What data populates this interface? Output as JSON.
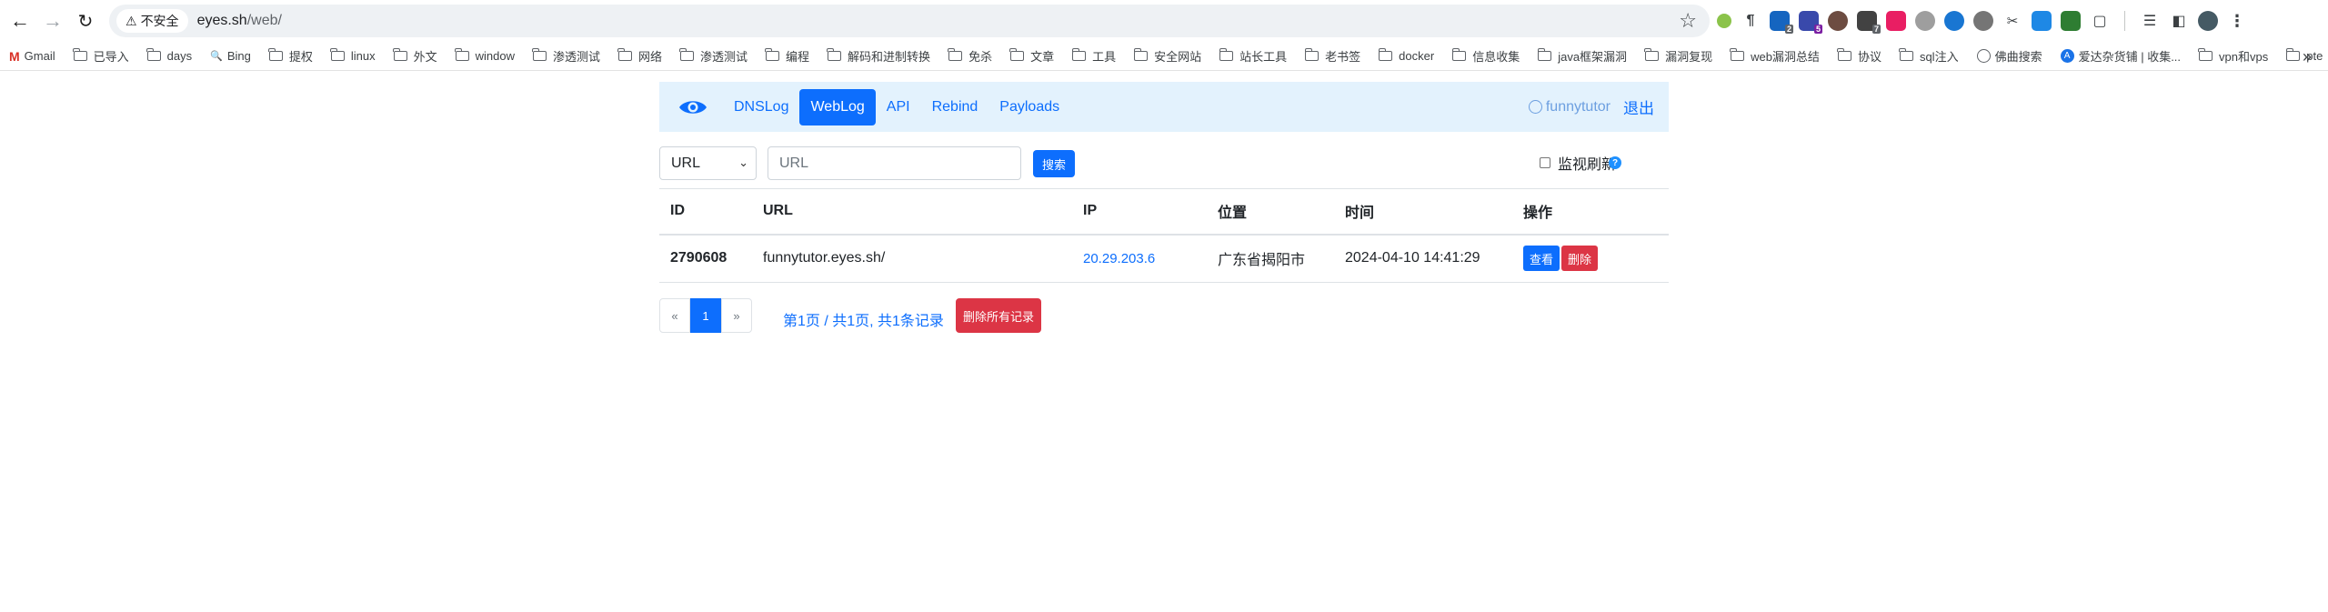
{
  "browser": {
    "security_label": "不安全",
    "url_host": "eyes.sh",
    "url_path": "/web/",
    "bookmarks": [
      {
        "label": "Gmail",
        "icon": "gmail-icon"
      },
      {
        "label": "已导入",
        "icon": "folder-icon"
      },
      {
        "label": "days",
        "icon": "folder-icon"
      },
      {
        "label": "Bing",
        "icon": "bing-search-icon"
      },
      {
        "label": "提权",
        "icon": "folder-icon"
      },
      {
        "label": "linux",
        "icon": "folder-icon"
      },
      {
        "label": "外文",
        "icon": "folder-icon"
      },
      {
        "label": "window",
        "icon": "folder-icon"
      },
      {
        "label": "渗透测试",
        "icon": "folder-icon"
      },
      {
        "label": "网络",
        "icon": "folder-icon"
      },
      {
        "label": "渗透测试",
        "icon": "folder-icon"
      },
      {
        "label": "编程",
        "icon": "folder-icon"
      },
      {
        "label": "解码和进制转换",
        "icon": "folder-icon"
      },
      {
        "label": "免杀",
        "icon": "folder-icon"
      },
      {
        "label": "文章",
        "icon": "folder-icon"
      },
      {
        "label": "工具",
        "icon": "folder-icon"
      },
      {
        "label": "安全网站",
        "icon": "folder-icon"
      },
      {
        "label": "站长工具",
        "icon": "folder-icon"
      },
      {
        "label": "老书签",
        "icon": "folder-icon"
      },
      {
        "label": "docker",
        "icon": "folder-icon"
      },
      {
        "label": "信息收集",
        "icon": "folder-icon"
      },
      {
        "label": "java框架漏洞",
        "icon": "folder-icon"
      },
      {
        "label": "漏洞复现",
        "icon": "folder-icon"
      },
      {
        "label": "web漏洞总结",
        "icon": "folder-icon"
      },
      {
        "label": "协议",
        "icon": "folder-icon"
      },
      {
        "label": "sql注入",
        "icon": "folder-icon"
      },
      {
        "label": "佛曲搜索",
        "icon": "globe-icon"
      },
      {
        "label": "爱达杂货铺 | 收集...",
        "icon": "site-a-icon"
      },
      {
        "label": "vpn和vps",
        "icon": "folder-icon"
      },
      {
        "label": "pte",
        "icon": "folder-icon"
      }
    ],
    "extension_badges": [
      "2",
      "7",
      "5"
    ]
  },
  "nav": {
    "logo_icon": "eye-icon",
    "links": [
      "DNSLog",
      "WebLog",
      "API",
      "Rebind",
      "Payloads"
    ],
    "active": "WebLog",
    "username": "funnytutor",
    "logout": "退出"
  },
  "filters": {
    "select_value": "URL",
    "input_placeholder": "URL",
    "search_label": "搜索",
    "watch_label": "监视刷新",
    "help_symbol": "?"
  },
  "table": {
    "headers": [
      "ID",
      "URL",
      "IP",
      "位置",
      "时间",
      "操作"
    ],
    "rows": [
      {
        "id": "2790608",
        "url": "funnytutor.eyes.sh/",
        "ip": "20.29.203.6",
        "location": "广东省揭阳市",
        "time": "2024-04-10 14:41:29",
        "view": "查看",
        "delete": "删除"
      }
    ]
  },
  "pagination": {
    "prev": "«",
    "current": "1",
    "next": "»",
    "info": "第1页 / 共1页, 共1条记录",
    "delete_all": "删除所有记录"
  },
  "colors": {
    "primary": "#0d6efd",
    "danger": "#dc3545",
    "navbar_bg": "#e3f2fd"
  }
}
